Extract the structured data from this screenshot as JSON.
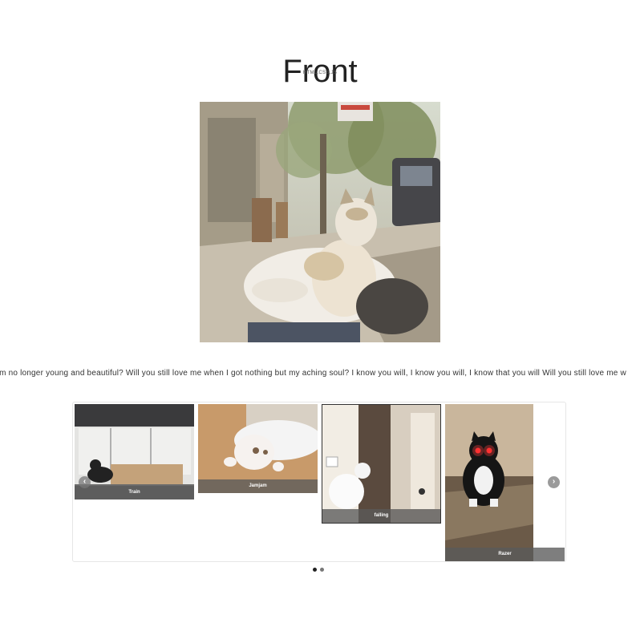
{
  "header": {
    "title": "Front",
    "subtitle": "HTML,CSS,JS"
  },
  "hero": {
    "icon": "cat-photo"
  },
  "marquee": {
    "text": "I'm no longer young and beautiful? Will you still love me when I got nothing but my aching soul? I know you will, I know you will, I know that you will Will you still love me w"
  },
  "carousel": {
    "slides": [
      {
        "caption": "Train"
      },
      {
        "caption": "Jamjam"
      },
      {
        "caption": "falling"
      },
      {
        "caption": "Razer"
      }
    ],
    "prev_label": "‹",
    "next_label": "›",
    "dots_total": 2,
    "active_dot": 1
  },
  "colors": {
    "caption_bg": "#5a5a5a",
    "dot_active": "#222222",
    "dot_inactive": "#777777"
  }
}
